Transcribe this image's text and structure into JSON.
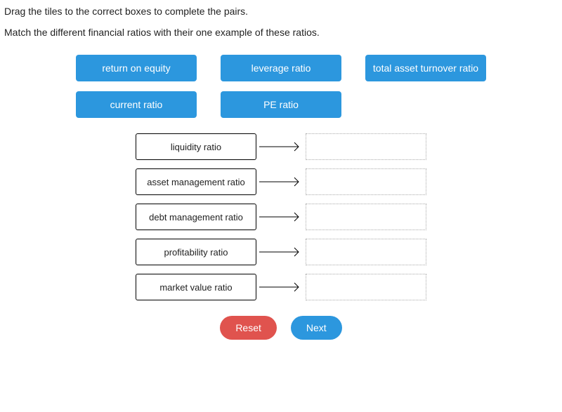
{
  "instructions": {
    "line1": "Drag the tiles to the correct boxes to complete the pairs.",
    "line2": "Match the different financial ratios with their one example of these ratios."
  },
  "tiles": {
    "row1": [
      {
        "label": "return on equity"
      },
      {
        "label": "leverage ratio"
      },
      {
        "label": "total asset turnover ratio"
      }
    ],
    "row2": [
      {
        "label": "current ratio"
      },
      {
        "label": "PE ratio"
      }
    ]
  },
  "pairs": [
    {
      "category": "liquidity ratio"
    },
    {
      "category": "asset management ratio"
    },
    {
      "category": "debt management ratio"
    },
    {
      "category": "profitability ratio"
    },
    {
      "category": "market value ratio"
    }
  ],
  "buttons": {
    "reset": "Reset",
    "next": "Next"
  }
}
